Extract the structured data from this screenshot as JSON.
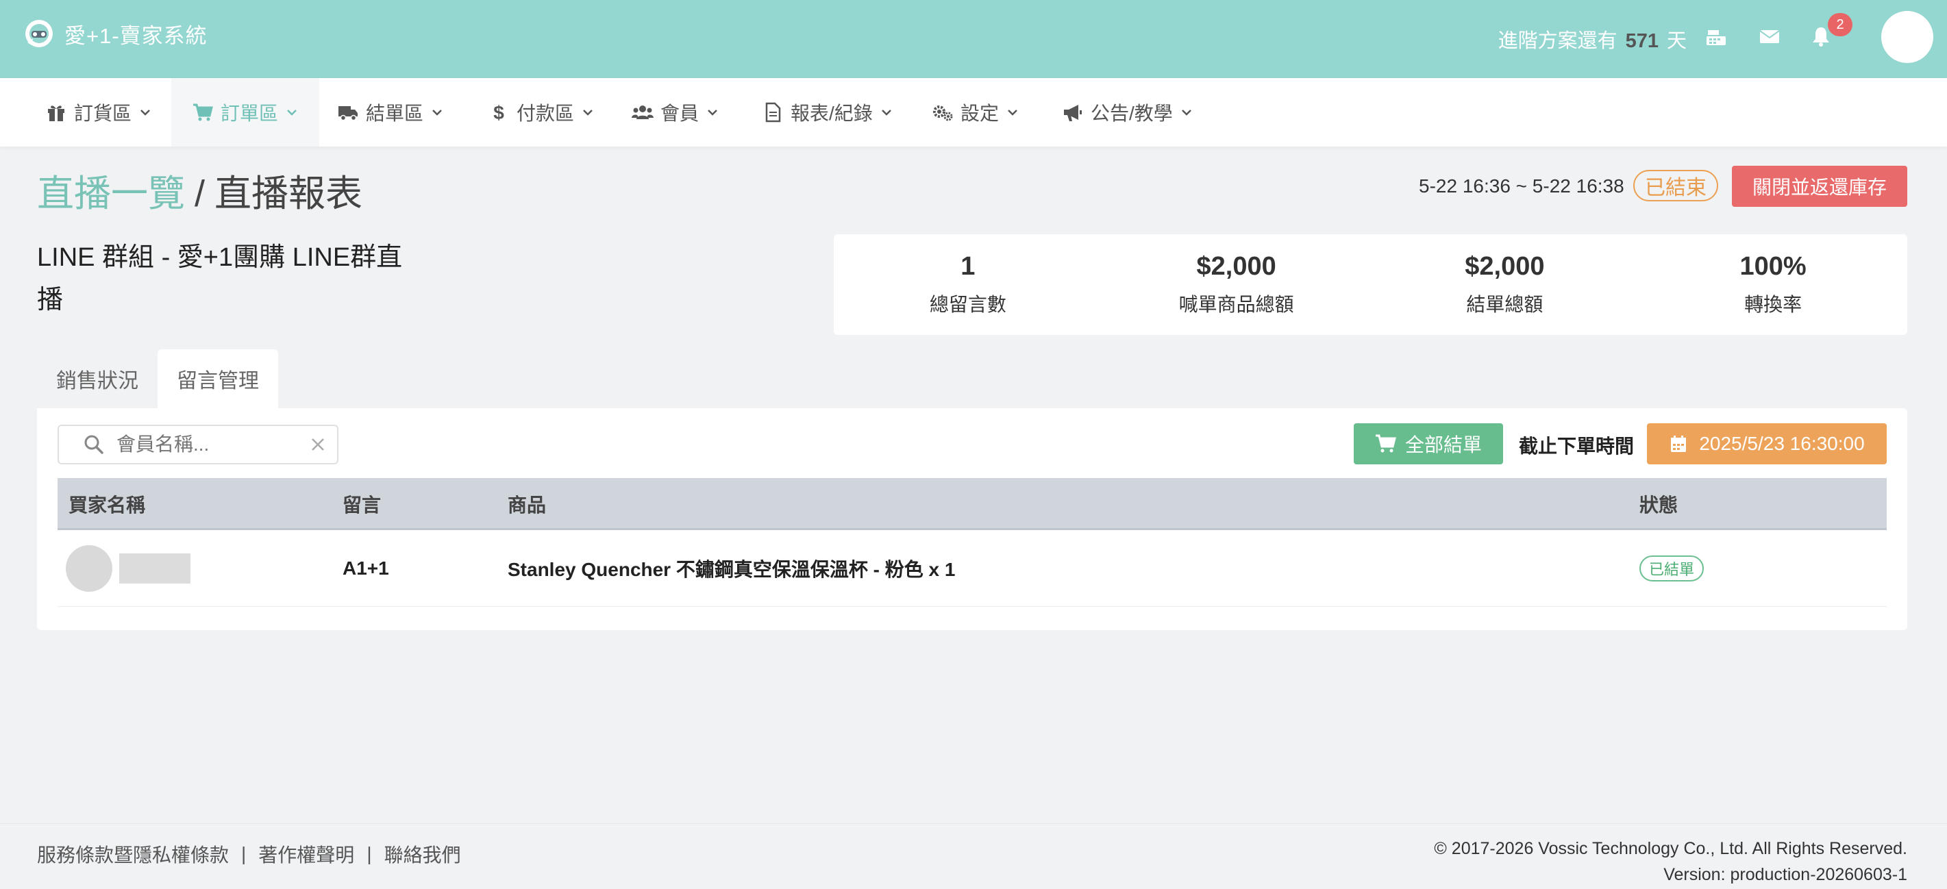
{
  "app": {
    "title": "愛+1-賣家系統",
    "plan_prefix": "進階方案還有",
    "plan_days": "571",
    "plan_suffix": "天",
    "notification_count": "2"
  },
  "nav": {
    "items": [
      {
        "label": "訂貨區",
        "icon": "gift-icon"
      },
      {
        "label": "訂單區",
        "icon": "cart-icon",
        "active": true
      },
      {
        "label": "結單區",
        "icon": "truck-icon"
      },
      {
        "label": "付款區",
        "icon": "dollar-icon"
      },
      {
        "label": "會員",
        "icon": "users-icon"
      },
      {
        "label": "報表/紀錄",
        "icon": "file-icon"
      },
      {
        "label": "設定",
        "icon": "gears-icon"
      },
      {
        "label": "公告/教學",
        "icon": "bullhorn-icon"
      }
    ]
  },
  "breadcrumb": {
    "parent": "直播一覽",
    "separator": "/",
    "current": "直播報表"
  },
  "live": {
    "time_range": "5-22 16:36 ~ 5-22 16:38",
    "status": "已結束",
    "close_button": "關閉並返還庫存",
    "group_name": "LINE 群組 - 愛+1團購 LINE群直播"
  },
  "stats": [
    {
      "value": "1",
      "label": "總留言數"
    },
    {
      "value": "$2,000",
      "label": "喊單商品總額"
    },
    {
      "value": "$2,000",
      "label": "結單總額"
    },
    {
      "value": "100%",
      "label": "轉換率"
    }
  ],
  "tabs": [
    {
      "label": "銷售狀況",
      "active": false
    },
    {
      "label": "留言管理",
      "active": true
    }
  ],
  "toolbar": {
    "search_placeholder": "會員名稱...",
    "checkout_all": "全部結單",
    "deadline_label": "截止下單時間",
    "deadline_value": "2025/5/23 16:30:00"
  },
  "table": {
    "headers": [
      "買家名稱",
      "留言",
      "商品",
      "狀態"
    ],
    "rows": [
      {
        "comment": "A1+1",
        "product": "Stanley Quencher 不鏽鋼真空保溫保溫杯 - 粉色 x 1",
        "status": "已結單"
      }
    ]
  },
  "footer": {
    "links": [
      "服務條款暨隱私權條款",
      "著作權聲明",
      "聯絡我們"
    ],
    "copyright": "© 2017-2026 Vossic Technology Co., Ltd. All Rights Reserved.",
    "version": "Version: production-20260603-1"
  },
  "colors": {
    "header_bg": "#94d6d0",
    "accent": "#79c2b6",
    "danger": "#e96a6a",
    "warning": "#eda35a",
    "success": "#68bd8e"
  }
}
